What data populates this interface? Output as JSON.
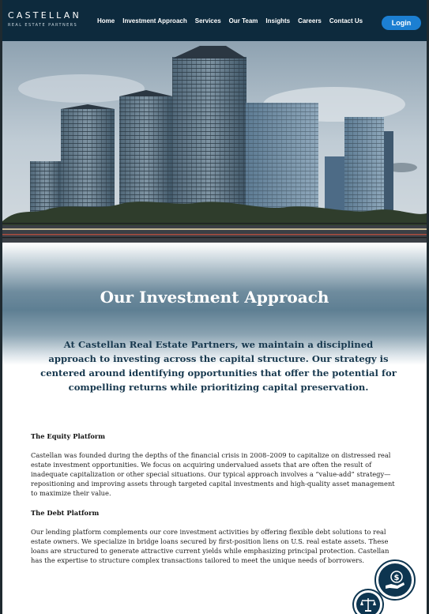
{
  "brand": {
    "name": "CASTELLAN",
    "tagline": "REAL ESTATE PARTNERS"
  },
  "nav": {
    "items": [
      "Home",
      "Investment Approach",
      "Services",
      "Our Team",
      "Insights",
      "Careers",
      "Contact Us"
    ],
    "login_label": "Login"
  },
  "hero": {
    "image": "city-skyline-photo"
  },
  "page": {
    "title": "Our Investment Approach",
    "intro": "At Castellan Real Estate Partners, we maintain a disciplined approach to investing across the capital structure. Our strategy is centered around identifying opportunities that offer the potential for compelling returns while prioritizing capital preservation."
  },
  "sections": [
    {
      "heading": "The Equity Platform",
      "body": "Castellan was founded during the depths of the financial crisis in 2008–2009 to capitalize on distressed real estate investment opportunities. We focus on acquiring undervalued assets that are often the result of inadequate capitalization or other special situations. Our typical approach involves a “value-add” strategy—repositioning and improving assets through targeted capital investments and high-quality asset management to maximize their value."
    },
    {
      "heading": "The Debt Platform",
      "body": "Our lending platform complements our core investment activities by offering flexible debt solutions to real estate owners. We specialize in bridge loans secured by first-position liens on U.S. real estate assets. These loans are structured to generate attractive current yields while emphasizing principal protection. Castellan has the expertise to structure complex transactions tailored to meet the unique needs of borrowers."
    }
  ],
  "icons": {
    "lending": "money-hand-icon",
    "scales": "balance-scale-icon"
  },
  "colors": {
    "nav_bg": "#0d2a3d",
    "login_bg": "#1c7fd2",
    "intro_text": "#17384e",
    "badge": "#0d3550"
  }
}
